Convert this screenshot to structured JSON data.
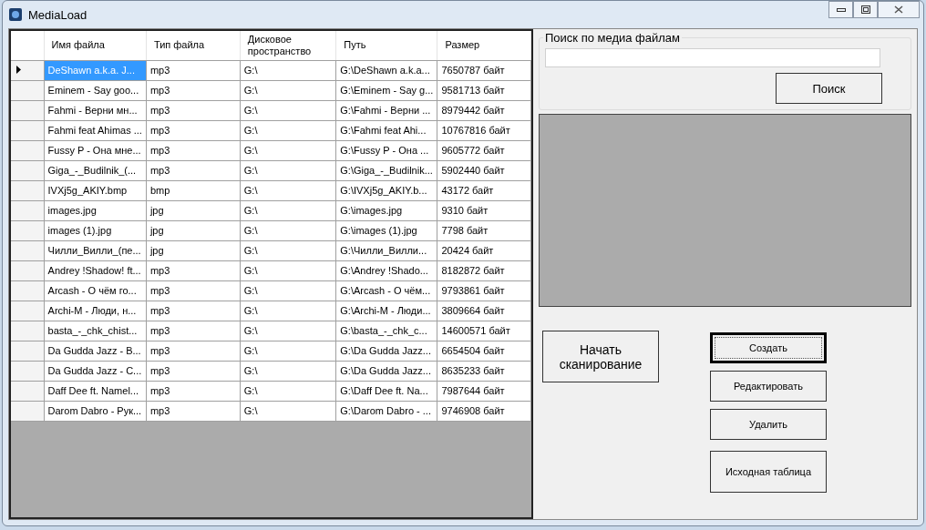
{
  "window": {
    "title": "MediaLoad"
  },
  "table": {
    "columns": [
      "Имя файла",
      "Тип файла",
      "Дисковое пространство",
      "Путь",
      "Размер"
    ],
    "rows": [
      {
        "selected": true,
        "cells": [
          "DeShawn a.k.a. J...",
          "mp3",
          "G:\\",
          "G:\\DeShawn a.k.a...",
          "7650787 байт"
        ]
      },
      {
        "selected": false,
        "cells": [
          "Eminem - Say goo...",
          "mp3",
          "G:\\",
          "G:\\Eminem - Say g...",
          "9581713 байт"
        ]
      },
      {
        "selected": false,
        "cells": [
          "Fahmi - Верни мн...",
          "mp3",
          "G:\\",
          "G:\\Fahmi - Верни ...",
          "8979442 байт"
        ]
      },
      {
        "selected": false,
        "cells": [
          "Fahmi feat Ahimas ...",
          "mp3",
          "G:\\",
          "G:\\Fahmi feat Ahi...",
          "10767816 байт"
        ]
      },
      {
        "selected": false,
        "cells": [
          "Fussy P - Она мне...",
          "mp3",
          "G:\\",
          "G:\\Fussy P - Она ...",
          "9605772 байт"
        ]
      },
      {
        "selected": false,
        "cells": [
          "Giga_-_Budilnik_(...",
          "mp3",
          "G:\\",
          "G:\\Giga_-_Budilnik...",
          "5902440 байт"
        ]
      },
      {
        "selected": false,
        "cells": [
          "IVXj5g_AKIY.bmp",
          "bmp",
          "G:\\",
          "G:\\IVXj5g_AKIY.b...",
          "43172 байт"
        ]
      },
      {
        "selected": false,
        "cells": [
          "images.jpg",
          "jpg",
          "G:\\",
          "G:\\images.jpg",
          "9310 байт"
        ]
      },
      {
        "selected": false,
        "cells": [
          "images (1).jpg",
          "jpg",
          "G:\\",
          "G:\\images (1).jpg",
          "7798 байт"
        ]
      },
      {
        "selected": false,
        "cells": [
          "Чилли_Вилли_(пе...",
          "jpg",
          "G:\\",
          "G:\\Чилли_Вилли...",
          "20424 байт"
        ]
      },
      {
        "selected": false,
        "cells": [
          "Andrey !Shadow! ft...",
          "mp3",
          "G:\\",
          "G:\\Andrey !Shado...",
          "8182872 байт"
        ]
      },
      {
        "selected": false,
        "cells": [
          "Arcash - О чём го...",
          "mp3",
          "G:\\",
          "G:\\Arcash - О чём...",
          "9793861 байт"
        ]
      },
      {
        "selected": false,
        "cells": [
          "Archi-M - Люди, н...",
          "mp3",
          "G:\\",
          "G:\\Archi-M - Люди...",
          "3809664 байт"
        ]
      },
      {
        "selected": false,
        "cells": [
          "basta_-_chk_chist...",
          "mp3",
          "G:\\",
          "G:\\basta_-_chk_c...",
          "14600571 байт"
        ]
      },
      {
        "selected": false,
        "cells": [
          "Da Gudda Jazz - B...",
          "mp3",
          "G:\\",
          "G:\\Da Gudda Jazz...",
          "6654504 байт"
        ]
      },
      {
        "selected": false,
        "cells": [
          "Da Gudda Jazz - C...",
          "mp3",
          "G:\\",
          "G:\\Da Gudda Jazz...",
          "8635233 байт"
        ]
      },
      {
        "selected": false,
        "cells": [
          "Daff Dee ft. Namel...",
          "mp3",
          "G:\\",
          "G:\\Daff Dee ft. Na...",
          "7987644 байт"
        ]
      },
      {
        "selected": false,
        "cells": [
          "Darom Dabro - Рук...",
          "mp3",
          "G:\\",
          "G:\\Darom Dabro - ...",
          "9746908 байт"
        ]
      }
    ]
  },
  "search": {
    "label": "Поиск по медиа файлам",
    "button": "Поиск"
  },
  "scan_button": "Начать сканирование",
  "buttons": [
    {
      "label": "Создать",
      "focused": true
    },
    {
      "label": "Редактировать",
      "focused": false
    },
    {
      "label": "Удалить",
      "focused": false
    },
    {
      "label": "Исходная таблица",
      "focused": false
    }
  ]
}
